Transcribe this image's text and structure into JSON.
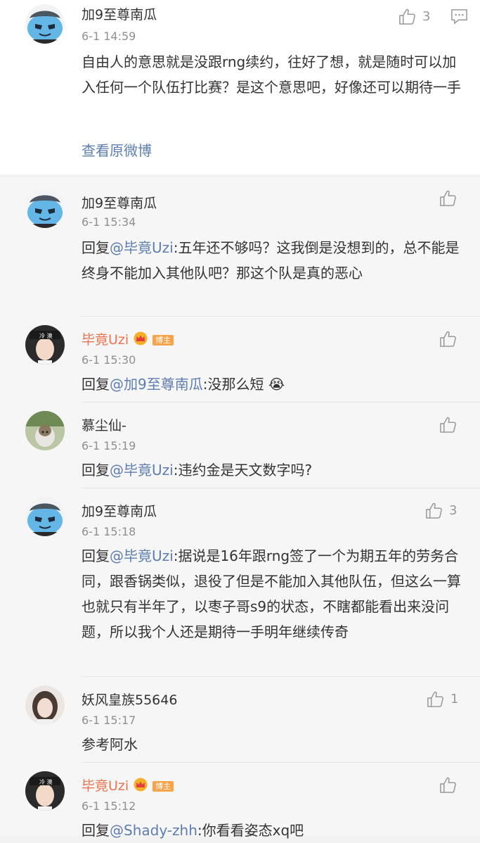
{
  "main_comment": {
    "user": "加9至尊南瓜",
    "time": "6-1 14:59",
    "likes": "3",
    "text": "自由人的意思就是没跟rng续约，往好了想，就是随时可以加入任何一个队伍打比赛？是这个意思吧，好像还可以期待一手",
    "view_original": "查看原微博"
  },
  "replies": [
    {
      "user": "加9至尊南瓜",
      "time": "6-1 15:34",
      "prefix": "回复",
      "mention": "@毕竟Uzi",
      "text": ":五年还不够吗？这我倒是没想到的，总不能是终身不能加入其他队吧？那这个队是真的恶心",
      "likes": ""
    },
    {
      "user": "毕竟Uzi",
      "badge": "博主",
      "time": "6-1 15:30",
      "prefix": "回复",
      "mention": "@加9至尊南瓜",
      "text": ":没那么短",
      "emoji": "😭",
      "likes": ""
    },
    {
      "user": "慕尘仙-",
      "time": "6-1 15:19",
      "prefix": "回复",
      "mention": "@毕竟Uzi",
      "text": ":违约金是天文数字吗?",
      "likes": ""
    },
    {
      "user": "加9至尊南瓜",
      "time": "6-1 15:18",
      "prefix": "回复",
      "mention": "@毕竟Uzi",
      "text": ":据说是16年跟rng签了一个为期五年的劳务合同，跟香锅类似，退役了但是不能加入其他队伍，但这么一算也就只有半年了，以枣子哥s9的状态，不瞎都能看出来没问题，所以我个人还是期待一手明年继续传奇",
      "likes": "3"
    },
    {
      "user": "妖风皇族55646",
      "time": "6-1 15:17",
      "text": "参考阿水",
      "likes": "1"
    },
    {
      "user": "毕竟Uzi",
      "badge": "博主",
      "time": "6-1 15:12",
      "prefix": "回复",
      "mention": "@Shady-zhh",
      "text": ":你看看姿态xq吧",
      "likes": ""
    }
  ],
  "colors": {
    "link": "#5d7db1",
    "blogger_name": "#eb7350",
    "badge": "#f7a34a"
  },
  "icons": {
    "like": "thumbs-up-icon",
    "comment": "comment-icon",
    "vip": "crown-icon"
  }
}
